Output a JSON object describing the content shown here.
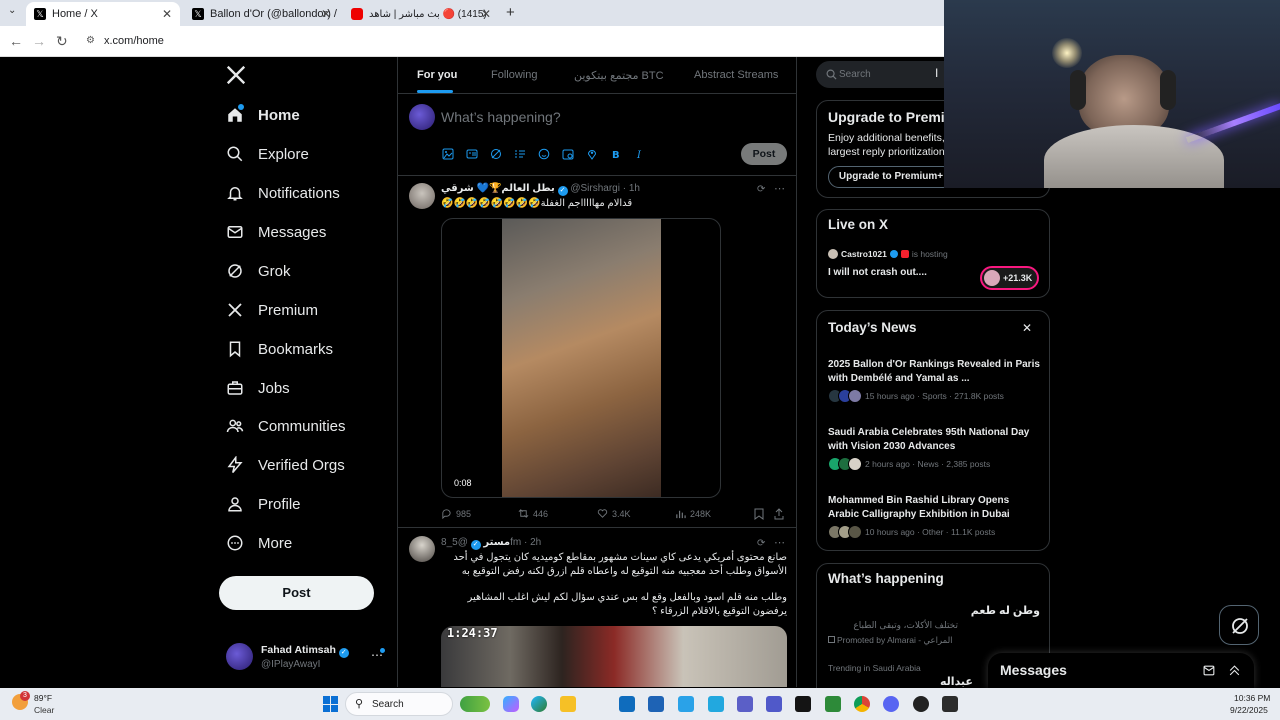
{
  "browser": {
    "tabs": [
      {
        "title": "Home / X",
        "active": true
      },
      {
        "title": "Ballon d'Or (@ballondor) / X",
        "active": false
      },
      {
        "title": "(1415) 🔴 بث مباشر | شاهد",
        "active": false
      }
    ],
    "url": "x.com/home"
  },
  "nav": {
    "items": [
      "Home",
      "Explore",
      "Notifications",
      "Messages",
      "Grok",
      "Premium",
      "Bookmarks",
      "Jobs",
      "Communities",
      "Verified Orgs",
      "Profile",
      "More"
    ],
    "post_label": "Post",
    "user": {
      "name": "Fahad Atimsah",
      "handle": "@IPlayAwayI"
    }
  },
  "feed": {
    "tabs": [
      "For you",
      "Following",
      "مجتمع بيتكوين BTC",
      "Abstract Streams"
    ],
    "composer_placeholder": "What’s happening?",
    "post_button": "Post",
    "tweet1": {
      "name": "بطل العالم🏆💙 شرقي",
      "handle": "@Sirshargi",
      "time": "· 1h",
      "text": "قدالام مهاااااجم الغفلة🤣🤣🤣🤣🤣🤣🤣🤣",
      "duration": "0:08",
      "replies": "985",
      "reposts": "446",
      "likes": "3.4K",
      "views": "248K"
    },
    "tweet2": {
      "name": "مستر",
      "handle": "@5_8fm",
      "time": "· 2h",
      "text1": "صانع محتوى أمريكي يدعى كاي سينات مشهور بمقاطع كوميديه كان يتجول في أحد الأسواق وطلب أحد معجبيه منه التوقيع له واعطاه قلم ازرق لكنه رفض التوقيع به",
      "text2": "وطلب منه قلم اسود وبالفعل وقع له بس عندي سؤال لكم ليش اغلب المشاهير يرفضون التوقيع بالاقلام الزرقاء ؟",
      "overlay_time": "1:24:37"
    }
  },
  "right": {
    "search_placeholder": "Search",
    "premium": {
      "title": "Upgrade to Premiu",
      "line1": "Enjoy additional benefits,",
      "line2": "largest reply prioritization",
      "button": "Upgrade to Premium+"
    },
    "live": {
      "title": "Live on X",
      "host": "Castro1021",
      "hosting": "is hosting",
      "text": "I will not crash out....",
      "count": "+21.3K"
    },
    "news": {
      "title": "Today’s News",
      "items": [
        {
          "title": "2025 Ballon d'Or Rankings Revealed in Paris with Dembélé and Yamal as ...",
          "meta": "15 hours ago · Sports · 271.8K posts"
        },
        {
          "title": "Saudi Arabia Celebrates 95th National Day with Vision 2030 Advances",
          "meta": "2 hours ago · News · 2,385 posts"
        },
        {
          "title": "Mohammed Bin Rashid Library Opens Arabic Calligraphy Exhibition in Dubai",
          "meta": "10 hours ago · Other · 11.1K posts"
        }
      ]
    },
    "happening": {
      "title": "What’s happening",
      "ad_title": "وطن له طعم",
      "ad_text": "تختلف الأكلات، وتبقى الطباع",
      "promoted": "Promoted by Almarai - المراعي",
      "trending_label": "Trending in Saudi Arabia",
      "trend_cut": "عبداله"
    },
    "messages_title": "Messages"
  },
  "taskbar": {
    "weather_temp": "89°F",
    "weather_desc": "Clear",
    "weather_badge": "3",
    "search_label": "Search",
    "time": "10:36 PM",
    "date": "9/22/2025"
  },
  "colors": {
    "accent": "#1d9bf0",
    "background": "#000000",
    "border": "#2f3336",
    "muted": "#71767b"
  }
}
